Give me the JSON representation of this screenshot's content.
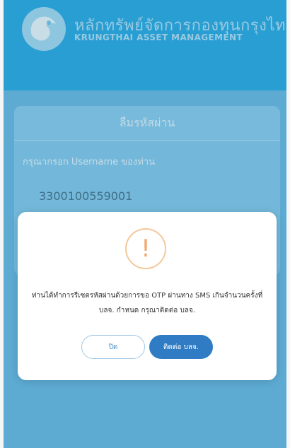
{
  "header": {
    "brand_thai": "หลักทรัพย์จัดการกองทุนกรุงไทย",
    "brand_english": "KRUNGTHAI ASSET MANAGEMENT",
    "logo_icon": "krungthai-bird-logo"
  },
  "form": {
    "title": "ลืมรหัสผ่าน",
    "prompt": "กรุณากรอก Username ของท่าน",
    "username_value": "3300100559001"
  },
  "dialog": {
    "icon": "exclamation-icon",
    "icon_glyph": "!",
    "message_line1": "ท่านได้ทำการรีเซตรหัสผ่านด้วยการขอ OTP ผ่านทาง SMS เกินจำนวนครั้งที่",
    "message_line2": "บลจ. กำหนด กรุณาติดต่อ บลจ.",
    "close_label": "ปิด",
    "contact_label": "ติดต่อ บลจ."
  },
  "colors": {
    "header_bg": "#1fa6e3",
    "body_bg": "#5fb6e3",
    "warning": "#f2a76c",
    "primary_button": "#2f7cc4"
  }
}
